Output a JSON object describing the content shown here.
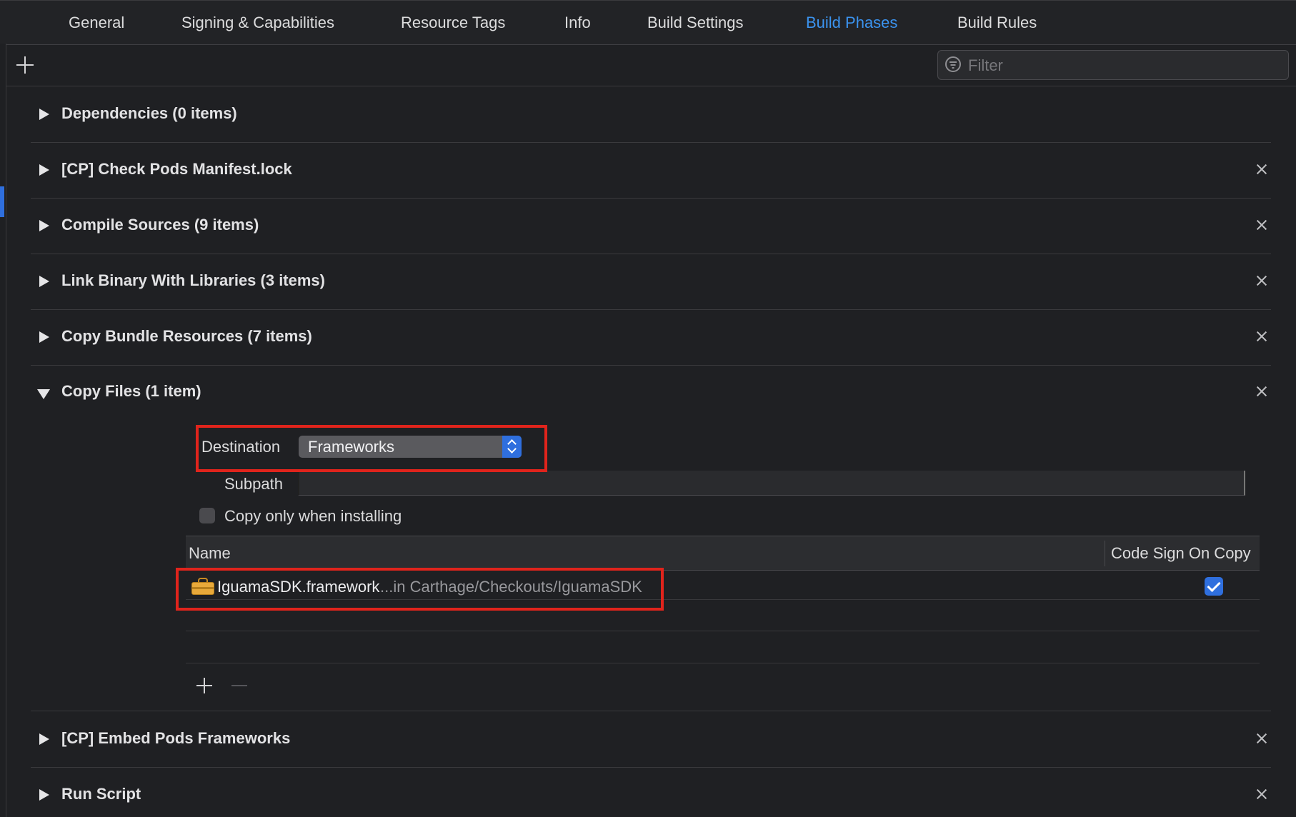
{
  "tabs": [
    {
      "label": "General",
      "active": false
    },
    {
      "label": "Signing & Capabilities",
      "active": false
    },
    {
      "label": "Resource Tags",
      "active": false
    },
    {
      "label": "Info",
      "active": false
    },
    {
      "label": "Build Settings",
      "active": false
    },
    {
      "label": "Build Phases",
      "active": true
    },
    {
      "label": "Build Rules",
      "active": false
    }
  ],
  "toolbar": {
    "add_icon": "plus-icon",
    "filter_placeholder": "Filter",
    "filter_icon": "filter-icon"
  },
  "phases": {
    "dependencies": "Dependencies (0 items)",
    "check_pods": "[CP] Check Pods Manifest.lock",
    "compile_sources": "Compile Sources (9 items)",
    "link_binary": "Link Binary With Libraries (3 items)",
    "copy_bundle": "Copy Bundle Resources (7 items)",
    "copy_files": "Copy Files (1 item)",
    "embed_pods": "[CP] Embed Pods Frameworks",
    "run_script": "Run Script"
  },
  "copy_files": {
    "destination_label": "Destination",
    "destination_value": "Frameworks",
    "subpath_label": "Subpath",
    "subpath_value": "",
    "copy_only_label": "Copy only when installing",
    "copy_only_checked": false,
    "table": {
      "col_name": "Name",
      "col_code_sign": "Code Sign On Copy",
      "rows": [
        {
          "name": "IguamaSDK.framework",
          "location": "...in Carthage/Checkouts/IguamaSDK",
          "code_sign": true,
          "icon": "framework-icon"
        }
      ]
    }
  },
  "colors": {
    "accent": "#2f6fde",
    "active_tab": "#3b93ef",
    "highlight_box": "#e0241c",
    "background": "#1f2023"
  }
}
